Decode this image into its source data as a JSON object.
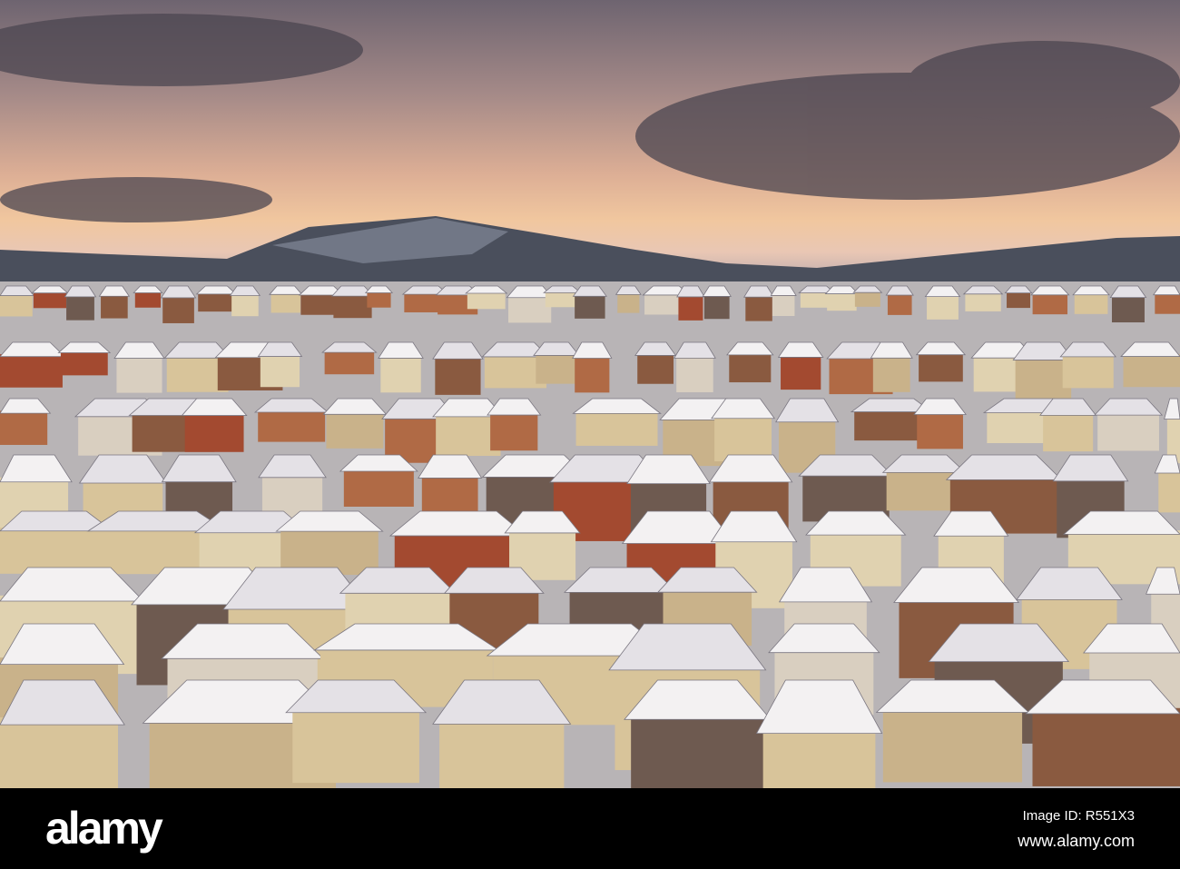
{
  "photo": {
    "description_alt": ""
  },
  "footer": {
    "logo": "alamy",
    "image_id": "Image ID: R551X3",
    "site": "www.alamy.com"
  }
}
